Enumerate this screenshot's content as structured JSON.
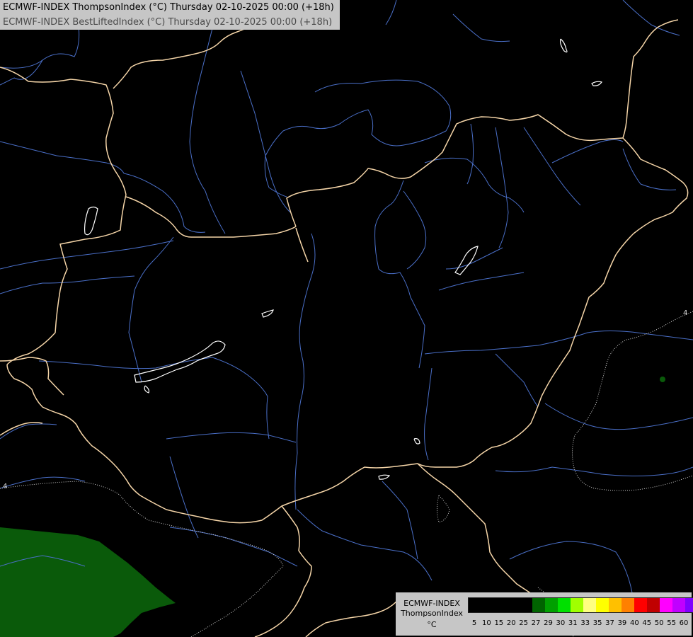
{
  "header": {
    "line1": "ECMWF-INDEX ThompsonIndex (°C) Thursday 02-10-2025 00:00 (+18h)",
    "line2": "ECMWF-INDEX BestLiftedIndex (°C) Thursday 02-10-2025 00:00 (+18h)"
  },
  "contour_labels": [
    "4",
    "4"
  ],
  "legend": {
    "model": "ECMWF-INDEX",
    "parameter": "ThompsonIndex",
    "unit": "°C",
    "colors": [
      "#000000",
      "#000000",
      "#000000",
      "#000000",
      "#000000",
      "#006400",
      "#00a000",
      "#00e000",
      "#a0ff00",
      "#ffff80",
      "#ffff00",
      "#ffc000",
      "#ff8000",
      "#ff0000",
      "#c00000",
      "#ff00ff",
      "#c000ff",
      "#8000ff",
      "#4000ff",
      "#0000ff"
    ],
    "ticks": [
      "5",
      "10",
      "15",
      "20",
      "25",
      "27",
      "29",
      "30",
      "31",
      "33",
      "35",
      "37",
      "39",
      "40",
      "45",
      "50",
      "55",
      "60"
    ]
  },
  "colors": {
    "border": "#f5d5a8",
    "river": "#4a6fc8",
    "lake": "#ffffff",
    "contour": "#d0d0d0",
    "thompson_green": "#0a5a0a"
  }
}
